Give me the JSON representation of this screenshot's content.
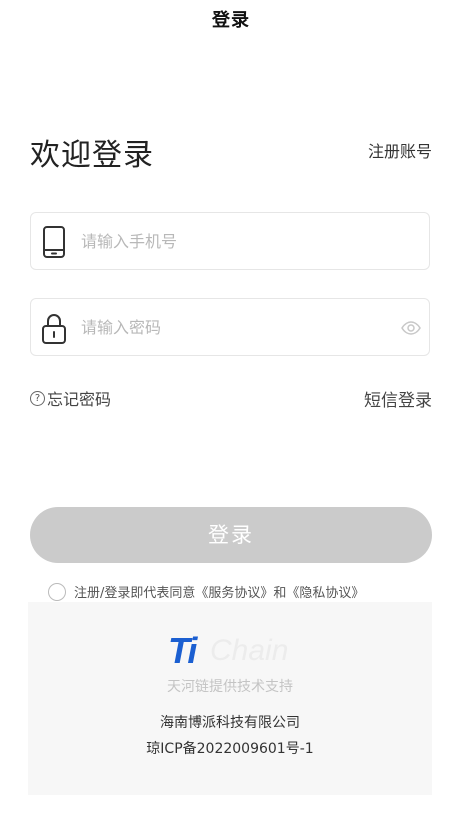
{
  "header": {
    "title": "登录"
  },
  "main": {
    "welcome": "欢迎登录",
    "register_link": "注册账号",
    "phone_field": {
      "placeholder": "请输入手机号",
      "value": "",
      "icon": "phone-icon"
    },
    "password_field": {
      "placeholder": "请输入密码",
      "value": "",
      "icon": "lock-icon",
      "toggle_icon": "eye-icon"
    },
    "forgot_password": "忘记密码",
    "sms_login": "短信登录",
    "login_button": "登录",
    "agreement": "注册/登录即代表同意《服务协议》和《隐私协议》"
  },
  "footer": {
    "logo_ti": "Ti",
    "logo_chain": "Chain",
    "tech_support": "天河链提供技术支持",
    "company": "海南博派科技有限公司",
    "icp": "琼ICP备2022009601号-1"
  },
  "colors": {
    "button_bg": "#cbcbcb",
    "logo_blue": "#1b5fd1",
    "placeholder": "#b8b8b8"
  }
}
